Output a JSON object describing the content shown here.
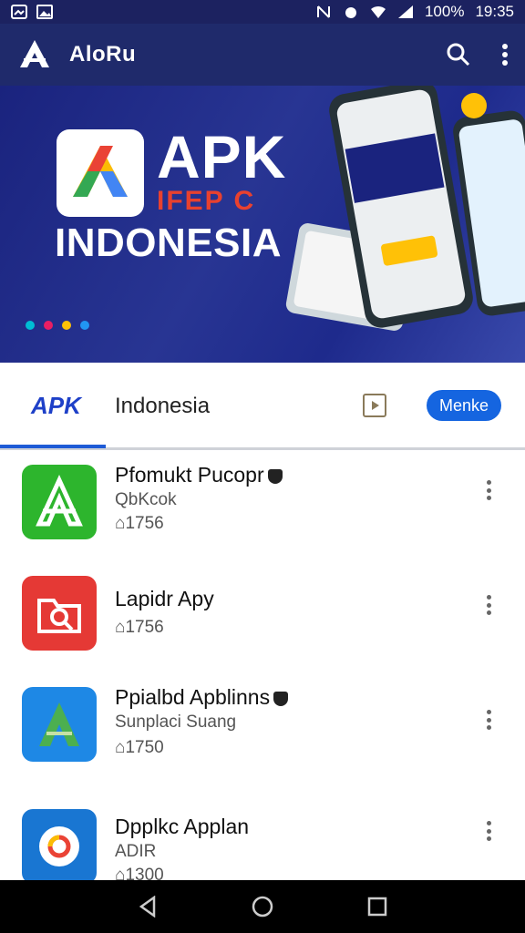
{
  "status_bar": {
    "battery": "100%",
    "time": "19:35"
  },
  "appbar": {
    "title": "AloRu",
    "icons": [
      "search-icon",
      "more-vert-icon"
    ]
  },
  "banner": {
    "brand": "APK",
    "tagline": "IFEP C",
    "country": "INDONESIA"
  },
  "tabs": {
    "apk_label": "APK",
    "indonesia_label": "Indonesia",
    "button_label": "Menke"
  },
  "apps": [
    {
      "name": "Pfomukt Pucopr",
      "developer": "QbKcok",
      "downloads": "1756",
      "verified": true,
      "color": "#2db52d"
    },
    {
      "name": "Lapidr Apy",
      "developer": "",
      "downloads": "1756",
      "verified": false,
      "color": "#e53935"
    },
    {
      "name": "Ppialbd Apblinns",
      "developer": "Sunplaci Suang",
      "downloads": "1750",
      "verified": true,
      "color": "#1e88e5"
    },
    {
      "name": "Dpplkc Applan",
      "developer": "ADIR",
      "downloads": "1300",
      "verified": false,
      "color": "#1976d2"
    }
  ],
  "colors": {
    "appbar": "#1f2a6b",
    "accent": "#1565e0",
    "banner_red": "#e8412f"
  }
}
